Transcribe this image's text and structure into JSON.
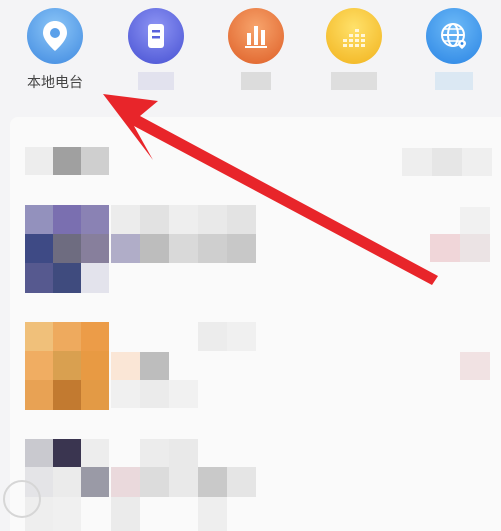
{
  "categories": [
    {
      "label": "本地电台",
      "icon": "location-pin-icon",
      "color_top": "#7bb8f2",
      "color_bottom": "#3b86e0"
    },
    {
      "label": "",
      "icon": "building-icon",
      "color_top": "#7d86f0",
      "color_bottom": "#4b55d6"
    },
    {
      "label": "",
      "icon": "bar-chart-icon",
      "color_top": "#f5985c",
      "color_bottom": "#e0642c"
    },
    {
      "label": "",
      "icon": "equalizer-icon",
      "color_top": "#ffd84d",
      "color_bottom": "#f2b620"
    },
    {
      "label": "",
      "icon": "globe-icon",
      "color_top": "#5cb0f5",
      "color_bottom": "#2a86e6"
    }
  ],
  "annotation": {
    "arrow_color": "#e8252a"
  }
}
